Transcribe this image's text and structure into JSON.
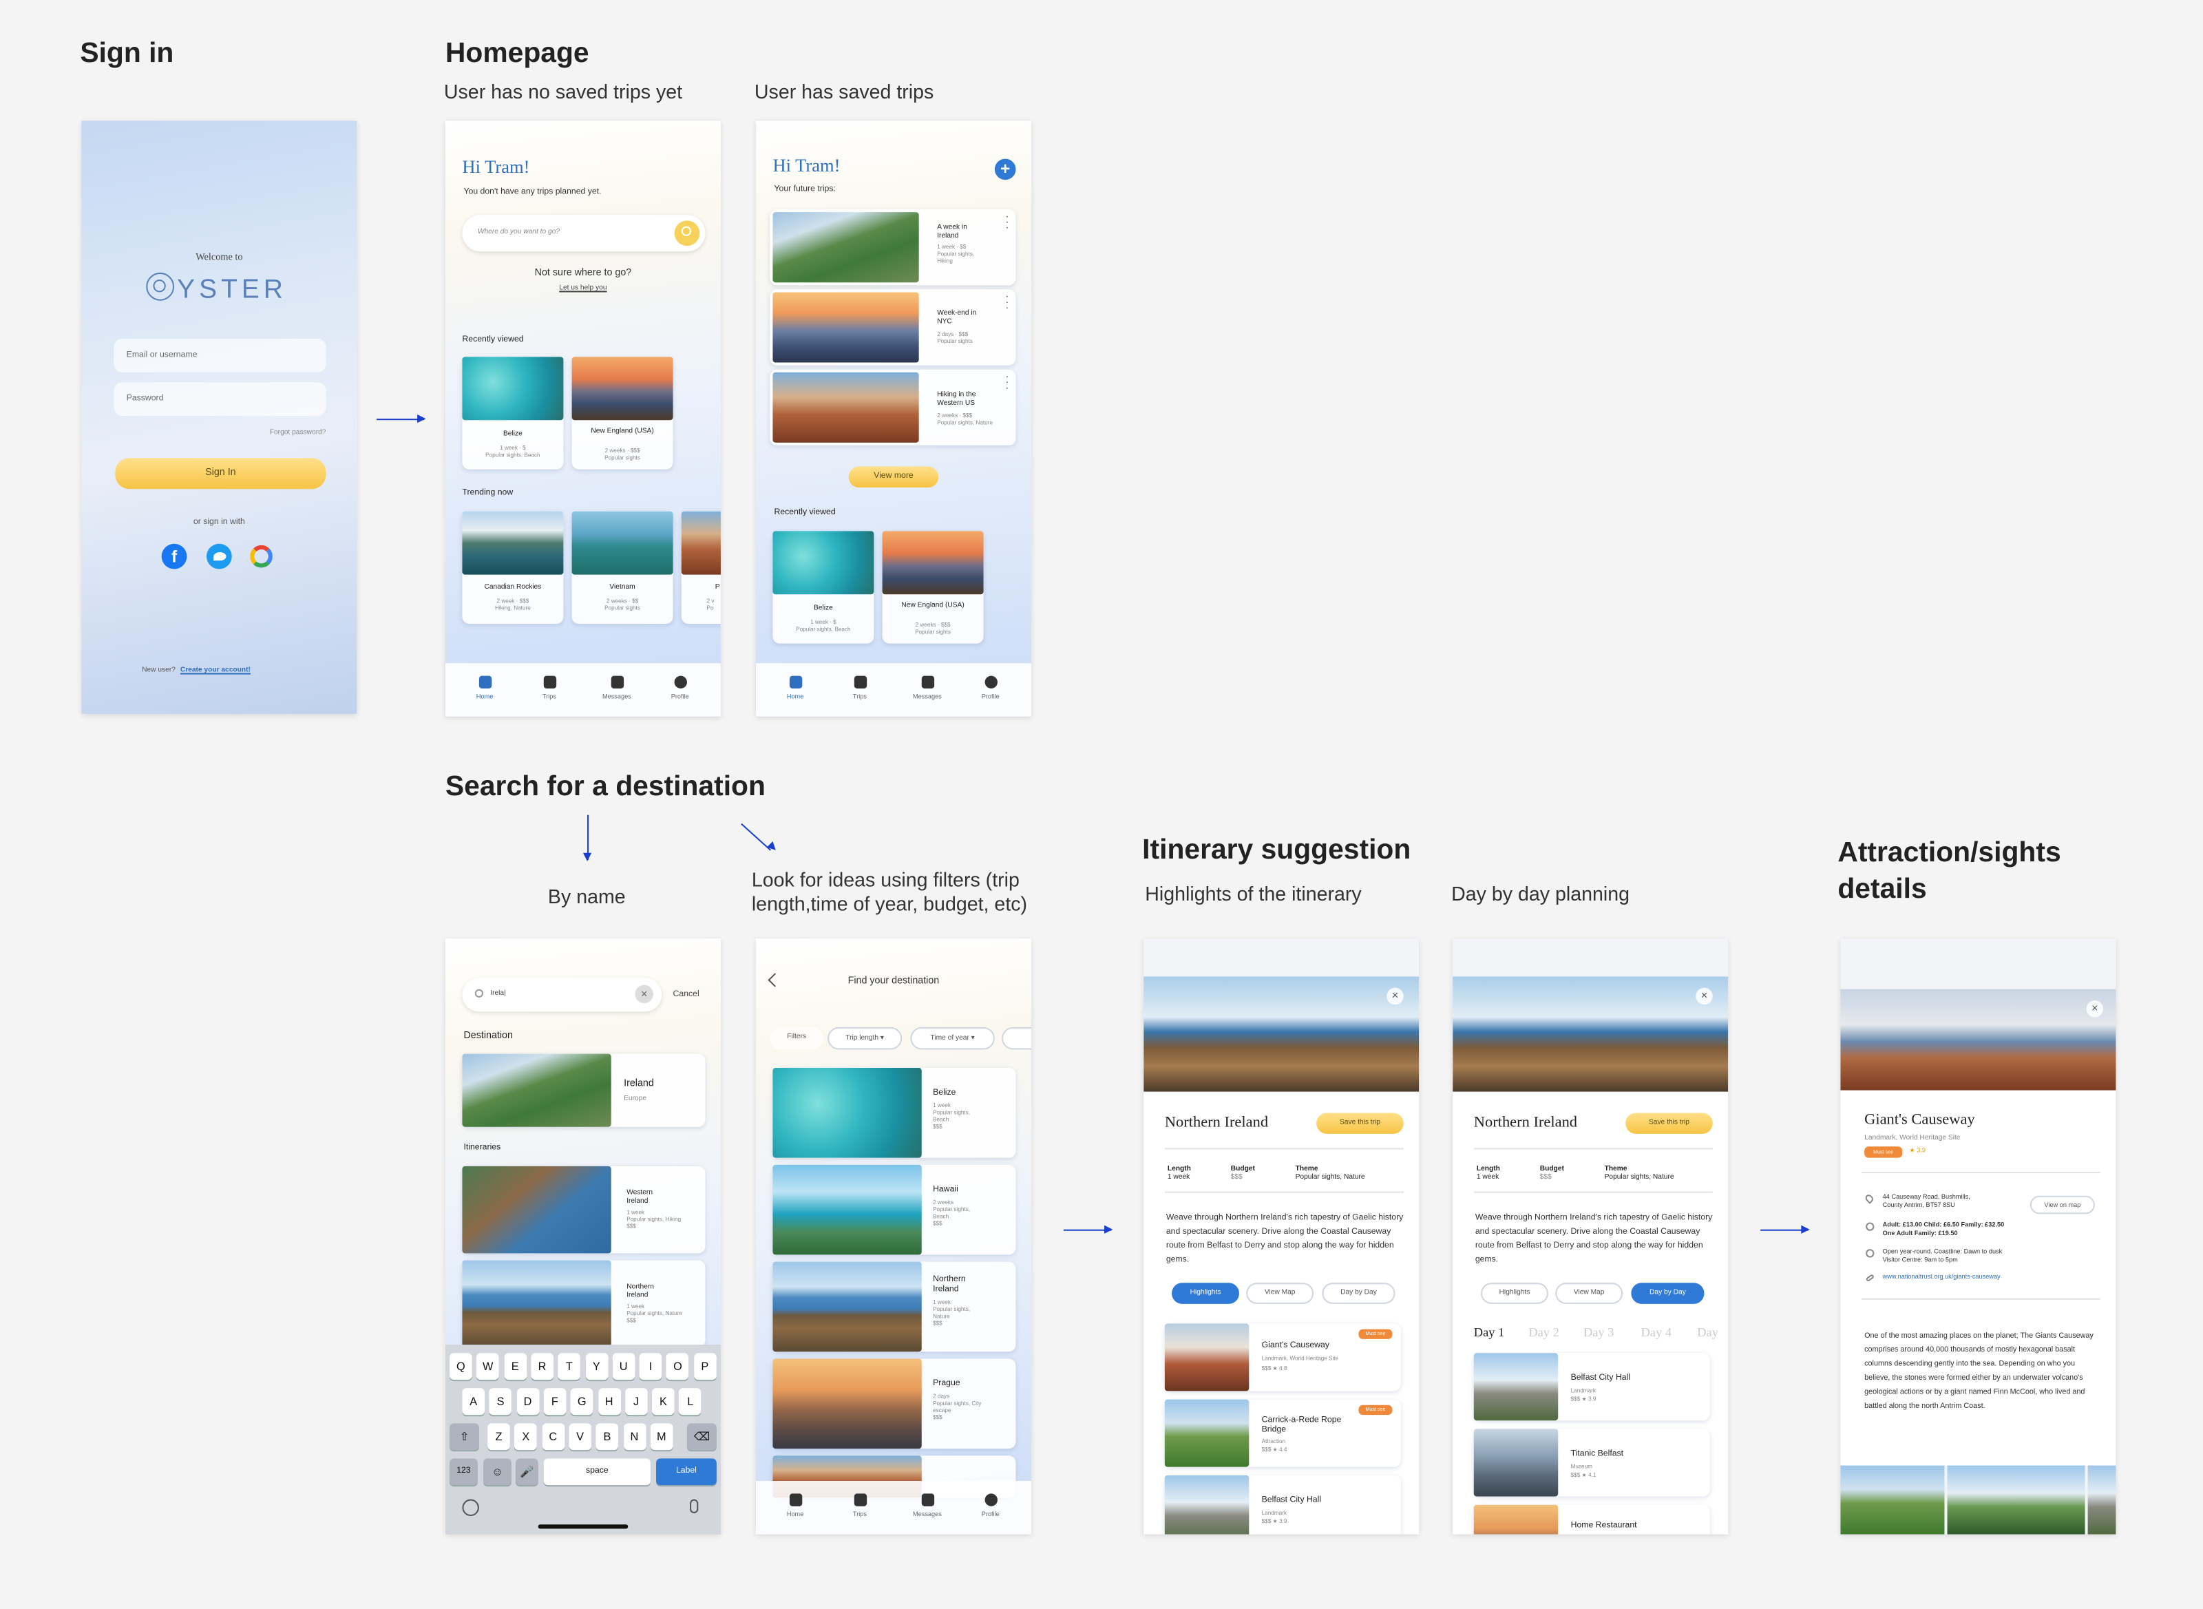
{
  "sections": {
    "signin": "Sign in",
    "homepage": "Homepage",
    "homepage_no_trips": "User has no saved trips yet",
    "homepage_saved": "User has saved trips",
    "search": "Search for a destination",
    "by_name": "By name",
    "filters": "Look for ideas using filters (trip length,time of year, budget, etc)",
    "itinerary": "Itinerary suggestion",
    "highlights": "Highlights of the itinerary",
    "daybyday": "Day by day planning",
    "attraction_l1": "Attraction/sights",
    "attraction_l2": "details"
  },
  "signin": {
    "welcome": "Welcome to",
    "logo": "YSTER",
    "email_placeholder": "Email or username",
    "password_placeholder": "Password",
    "forgot": "Forgot password?",
    "button": "Sign In",
    "or_sign_in": "or sign in with",
    "new_user": "New user?",
    "create": "Create your account!"
  },
  "home1": {
    "greeting": "Hi Tram!",
    "subtitle": "You don't have any trips planned yet.",
    "search_placeholder": "Where do you want to go?",
    "not_sure": "Not sure where to go?",
    "let_us_help": "Let us help you",
    "recently_viewed": "Recently viewed",
    "trending": "Trending now",
    "recent": [
      {
        "name": "Belize",
        "l1": "1 week · $",
        "l2": "Popular sights, Beach"
      },
      {
        "name": "New England (USA)",
        "l1": "2 weeks · $$$",
        "l2": "Popular sights"
      }
    ],
    "trend": [
      {
        "name": "Canadian Rockies",
        "l1": "2 week · $$$",
        "l2": "Hiking, Nature"
      },
      {
        "name": "Vietnam",
        "l1": "2 weeks · $$",
        "l2": "Popular sights"
      },
      {
        "name": "P",
        "l1": "2 v",
        "l2": "Po"
      }
    ]
  },
  "nav": {
    "home": "Home",
    "trips": "Trips",
    "messages": "Messages",
    "profile": "Profile"
  },
  "home2": {
    "greeting": "Hi Tram!",
    "subtitle": "Your future trips:",
    "trips": [
      {
        "l1": "A week in",
        "l2": "Ireland",
        "m1": "1 week · $$",
        "m2": "Popular sights,",
        "m3": "Hiking"
      },
      {
        "l1": "Week-end in",
        "l2": "NYC",
        "m1": "2 days · $$$",
        "m2": "Popular sights",
        "m3": ""
      },
      {
        "l1": "Hiking in the",
        "l2": "Western US",
        "m1": "2 weeks · $$$",
        "m2": "Popular sights, Nature",
        "m3": ""
      }
    ],
    "view_more": "View more",
    "recently_viewed": "Recently viewed",
    "recent": [
      {
        "name": "Belize",
        "l1": "1 week · $",
        "l2": "Popular sights, Beach"
      },
      {
        "name": "New England (USA)",
        "l1": "2 weeks · $$$",
        "l2": "Popular sights"
      }
    ]
  },
  "search1": {
    "query": "Irela|",
    "cancel": "Cancel",
    "destination": "Destination",
    "dest_name": "Ireland",
    "dest_region": "Europe",
    "itineraries": "Itineraries",
    "it": [
      {
        "l1": "Western",
        "l2": "Ireland",
        "m1": "1 week",
        "m2": "Popular sights, Hiking",
        "m3": "$$$"
      },
      {
        "l1": "Northern",
        "l2": "Ireland",
        "m1": "1 week",
        "m2": "Popular sights, Nature",
        "m3": "$$$"
      }
    ],
    "row1": [
      "Q",
      "W",
      "E",
      "R",
      "T",
      "Y",
      "U",
      "I",
      "O",
      "P"
    ],
    "row2": [
      "A",
      "S",
      "D",
      "F",
      "G",
      "H",
      "J",
      "K",
      "L"
    ],
    "row3": [
      "Z",
      "X",
      "C",
      "V",
      "B",
      "N",
      "M"
    ],
    "k123": "123",
    "space": "space",
    "label": "Label"
  },
  "search2": {
    "title": "Find your destination",
    "filters": "Filters",
    "trip_length": "Trip length ▾",
    "time_of_year": "Time of year ▾",
    "results": [
      {
        "l1": "Belize",
        "m1": "1 week",
        "m2": "Popular sights,",
        "m3": "Beach",
        "m4": "$$$"
      },
      {
        "l1": "Hawaii",
        "m1": "2 weeks",
        "m2": "Popular sights,",
        "m3": "Beach",
        "m4": "$$$"
      },
      {
        "l1": "Northern",
        "l1b": "Ireland",
        "m1": "1 week",
        "m2": "Popular sights,",
        "m3": "Nature",
        "m4": "$$$"
      },
      {
        "l1": "Prague",
        "m1": "2 days",
        "m2": "Popular sights, City",
        "m3": "escape",
        "m4": "$$$"
      }
    ]
  },
  "itin1": {
    "title": "Northern Ireland",
    "save": "Save this trip",
    "length_label": "Length",
    "length_val": "1 week",
    "budget_label": "Budget",
    "budget_val": "$$$",
    "theme_label": "Theme",
    "theme_val": "Popular sights, Nature",
    "desc": "Weave through Northern Ireland's rich tapestry of Gaelic history and spectacular scenery. Drive along the Coastal Causeway route from Belfast to Derry and stop along the way for hidden gems.",
    "tab_highlights": "Highlights",
    "tab_map": "View Map",
    "tab_day": "Day by Day",
    "items": [
      {
        "name": "Giant's Causeway",
        "sub": "Landmark, World Heritage Site",
        "meta": "$$$  ★ 4.8",
        "tag": "Must see"
      },
      {
        "name": "Carrick-a-Rede Rope Bridge",
        "sub": "Attraction",
        "meta": "$$$  ★ 4.4",
        "tag": "Must see"
      },
      {
        "name": "Belfast City Hall",
        "sub": "Landmark",
        "meta": "$$$  ★ 3.9",
        "tag": ""
      }
    ]
  },
  "itin2": {
    "title": "Northern Ireland",
    "save": "Save this trip",
    "length_label": "Length",
    "length_val": "1 week",
    "budget_label": "Budget",
    "budget_val": "$$$",
    "theme_label": "Theme",
    "theme_val": "Popular sights, Nature",
    "desc": "Weave through Northern Ireland's rich tapestry of Gaelic history and spectacular scenery. Drive along the Coastal Causeway route from Belfast to Derry and stop along the way for hidden gems.",
    "tab_highlights": "Highlights",
    "tab_map": "View Map",
    "tab_day": "Day by Day",
    "days": [
      "Day 1",
      "Day 2",
      "Day 3",
      "Day 4",
      "Day"
    ],
    "items": [
      {
        "name": "Belfast City Hall",
        "sub": "Landmark",
        "meta": "$$$  ★ 3.9"
      },
      {
        "name": "Titanic Belfast",
        "sub": "Museum",
        "meta": "$$$  ★ 4.1"
      },
      {
        "name": "Home Restaurant",
        "sub": "",
        "meta": ""
      }
    ]
  },
  "attraction": {
    "name": "Giant's Causeway",
    "sub": "Landmark, World Heritage Site",
    "tag": "Must see",
    "rating": "★ 3.9",
    "addr1": "44 Causeway Road, Bushmills,",
    "addr2": "County Antrim, BT57 8SU",
    "view_map": "View on map",
    "price1": "Adult: £13.00  Child: £6.50  Family: £32.50",
    "price2": "One Adult Family:  £19.50",
    "hours1": "Open year-round. Coastline: Dawn to dusk",
    "hours2": "Visitor Centre: 9am to 5pm",
    "url": "www.nationaltrust.org.uk/giants-causeway",
    "desc": "One of the most amazing places on the planet; The Giants Causeway comprises around 40,000 thousands of mostly hexagonal basalt columns descending gently into the sea. Depending on who you believe, the stones were formed either by an underwater volcano's geological actions or by a giant named Finn McCool, who lived and battled along the north Antrim Coast."
  },
  "colors": {
    "accent": "#2f6fc0",
    "yellow": "#f6c445",
    "orange": "#f08a3a",
    "arrow": "#1a3fcf"
  }
}
